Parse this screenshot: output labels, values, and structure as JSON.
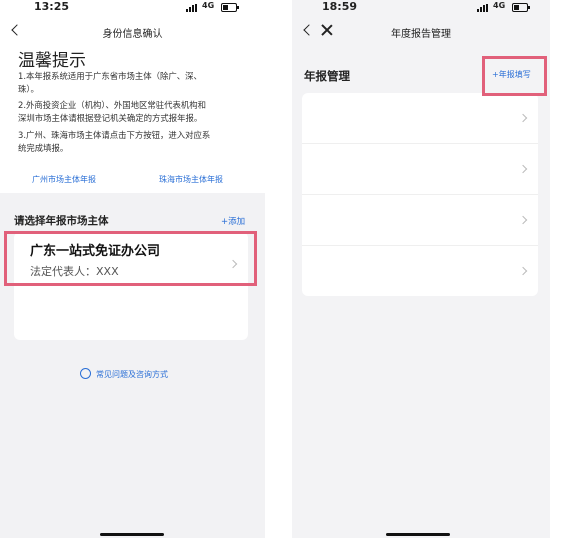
{
  "left_screen": {
    "status": {
      "time": "13:25",
      "network": "4G"
    },
    "nav_title": "身份信息确认",
    "tips": {
      "title": "温馨提示",
      "line1": "1.本年报系统适用于广东省市场主体（除广、深、\n珠）。",
      "line2": "2.外商投资企业（机构）、外国地区常驻代表机构和\n深圳市场主体请根据登记机关确定的方式报年报。",
      "line3": "3.广州、珠海市场主体请点击下方按钮，进入对应系\n统完成填报。"
    },
    "links": {
      "guangzhou": "广州市场主体年报",
      "zhuhai": "珠海市场主体年报"
    },
    "select": {
      "title": "请选择年报市场主体",
      "add": "+添加"
    },
    "company": {
      "name": "广东一站式免证办公司",
      "rep": "法定代表人：XXX"
    },
    "faq": "常见问题及咨询方式"
  },
  "right_screen": {
    "status": {
      "time": "18:59",
      "network": "4G"
    },
    "nav_title": "年度报告管理",
    "section_title": "年报管理",
    "fill_link": "+年报填写",
    "rows": [
      "",
      "",
      "",
      ""
    ]
  },
  "colors": {
    "link": "#2a6fd6",
    "highlight": "#e1607a",
    "panel": "#f2f2f4"
  }
}
